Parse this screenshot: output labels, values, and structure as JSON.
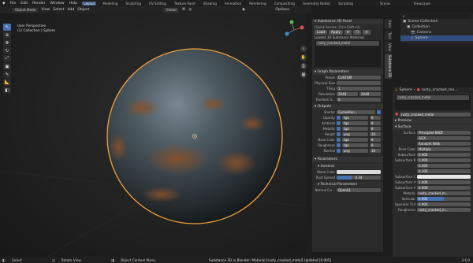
{
  "topbar": {
    "menus": [
      "File",
      "Edit",
      "Render",
      "Window",
      "Help"
    ],
    "workspaces": [
      "Layout",
      "Modeling",
      "Sculpting",
      "UV Editing",
      "Texture Paint",
      "Shading",
      "Animation",
      "Rendering",
      "Compositing",
      "Geometry Nodes",
      "Scripting"
    ],
    "active_workspace": "Layout",
    "scene": "Scene",
    "view_layer": "ViewLayer"
  },
  "viewport_header": {
    "mode": "Object Mode",
    "menus": [
      "View",
      "Select",
      "Add",
      "Object"
    ],
    "orientation": "Global",
    "options": "Options"
  },
  "viewport": {
    "title": "User Perspective",
    "subtitle": "(1) Collection | Sphere"
  },
  "substance_panel": {
    "title": "Substance 3D Panel",
    "quick_access": "(Quick Access: Ctrl+Shift+U)",
    "load": "Load",
    "apply": "Apply",
    "loaded_label": "Loaded 3D Substance Materials",
    "material": "rusty_cracked_metal",
    "graph_parameters": "Graph Parameters",
    "preset_label": "Preset",
    "preset_value": "CUSTOM",
    "physical_size_label": "Physical Size",
    "tiling_label": "Tiling",
    "tiling_value": "1",
    "resolution_label": "Resolution",
    "resolution_value": "2048",
    "resolution_value2": "2048",
    "random_seed_label": "Random S...",
    "random_seed_value": "0",
    "outputs": "Outputs",
    "shader_label": "Shader",
    "shader_value": "CyclesRen...",
    "output_rows": [
      {
        "name": "Opacity",
        "format": "tga",
        "bits": "8"
      },
      {
        "name": "Ambient",
        "format": "tga",
        "bits": "8"
      },
      {
        "name": "Metallic",
        "format": "tga",
        "bits": "8"
      },
      {
        "name": "Height",
        "format": "png",
        "bits": "16"
      },
      {
        "name": "Base Color",
        "format": "tga",
        "bits": "8"
      },
      {
        "name": "Roughness",
        "format": "tga",
        "bits": "8"
      },
      {
        "name": "Normal",
        "format": "png",
        "bits": "16"
      }
    ],
    "parameters": "Parameters",
    "general": "General",
    "metal_color_label": "Metal Color",
    "rust_spread_label": "Rust Spread",
    "rust_spread_value": "0.34",
    "technical_parameters": "Technical Parameters",
    "normal_format_label": "Normal For...",
    "normal_format_value": "OpenGL"
  },
  "vertical_tabs": [
    "Item",
    "Tool",
    "View",
    "Substance 3D"
  ],
  "outliner": {
    "title": "Scene Collection",
    "items": [
      "Collection",
      "Camera",
      "Sphere"
    ]
  },
  "properties": {
    "object": "Sphere",
    "material_crumb": "rusty_cracked_me...",
    "slot_material": "rusty_cracked_metal",
    "data_material": "rusty_cracked_metal",
    "preview": "Preview",
    "surface_header": "Surface",
    "surface_label": "Surface",
    "surface_value": "Principled BSDF",
    "distribution": "GGX",
    "subsurface_method": "Random Walk",
    "base_color_label": "Base Color",
    "base_color_value": "Multiply",
    "subsurface_label": "Subsurface",
    "subsurface_value": "0.000",
    "subsurface_r_label": "Subsurface R...",
    "subsurface_r_values": [
      "1.000",
      "0.200",
      "0.100"
    ],
    "subsurface_c_label": "Subsurface C...",
    "subsurface_ior_label": "Subsurface IOR",
    "subsurface_ior_value": "1.400",
    "subsurface_a_label": "Subsurface A...",
    "subsurface_a_value": "0.000",
    "metallic_label": "Metallic",
    "metallic_value": "rusty_cracked_m...",
    "specular_label": "Specular",
    "specular_value": "0.500",
    "specular_tint_label": "Specular Tint",
    "specular_tint_value": "0.000",
    "roughness_label": "Roughness",
    "roughness_value": "rusty_cracked_m..."
  },
  "statusbar": {
    "select": "Select",
    "rotate": "Rotate View",
    "context": "Object Context Menu",
    "message": "Substance 3D in Blender: Material [rusty_cracked_metal] Updated [0.005]",
    "version": "3.6.0"
  },
  "colors": {
    "accent": "#4772b3",
    "selection_outline": "#f0a23c",
    "metal_color": "#d9d9d9",
    "rust_spread_fill": "#4772b3"
  }
}
